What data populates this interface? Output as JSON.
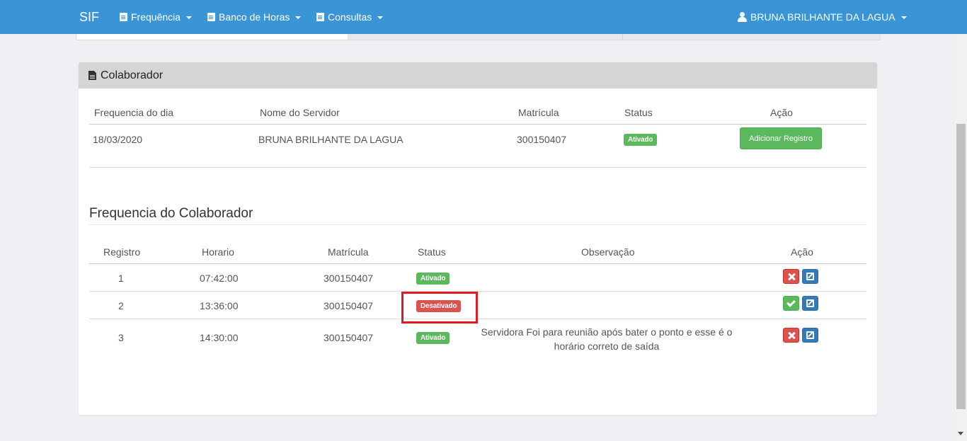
{
  "navbar": {
    "brand": "SIF",
    "menus": [
      {
        "label": "Frequência",
        "icon": "calendar-clock-icon"
      },
      {
        "label": "Banco de Horas",
        "icon": "document-icon"
      },
      {
        "label": "Consultas",
        "icon": "document-search-icon"
      }
    ],
    "user": {
      "label": "BRUNA BRILHANTE DA LAGUA",
      "icon": "user-icon"
    },
    "color": "#3a95d6"
  },
  "colaborador_panel": {
    "title": "Colaborador",
    "headers": [
      "Frequencia do dia",
      "Nome do Servidor",
      "Matrícula",
      "Status",
      "Ação"
    ],
    "row": {
      "data": "18/03/2020",
      "nome": "BRUNA BRILHANTE DA LAGUA",
      "matricula": "300150407",
      "status": "Ativado",
      "action_label": "Adicionar Registro"
    }
  },
  "frequencia": {
    "title": "Frequencia do Colaborador",
    "headers": [
      "Registro",
      "Horario",
      "Matrícula",
      "Status",
      "Observação",
      "Ação"
    ],
    "rows": [
      {
        "registro": "1",
        "horario": "07:42:00",
        "matricula": "300150407",
        "status": "Ativado",
        "observacao": "",
        "status_color": "#5cb85c"
      },
      {
        "registro": "2",
        "horario": "13:36:00",
        "matricula": "300150407",
        "status": "Desativado",
        "observacao": "",
        "status_color": "#d9534f"
      },
      {
        "registro": "3",
        "horario": "14:30:00",
        "matricula": "300150407",
        "status": "Ativado",
        "observacao_line1": "Servidora Foi para reunião após bater o ponto e esse é o",
        "observacao_line2": "horário correto de saída",
        "status_color": "#5cb85c"
      }
    ]
  },
  "colors": {
    "success": "#5cb85c",
    "danger": "#d9534f",
    "primary": "#337ab7",
    "highlight": "#e01b24"
  }
}
